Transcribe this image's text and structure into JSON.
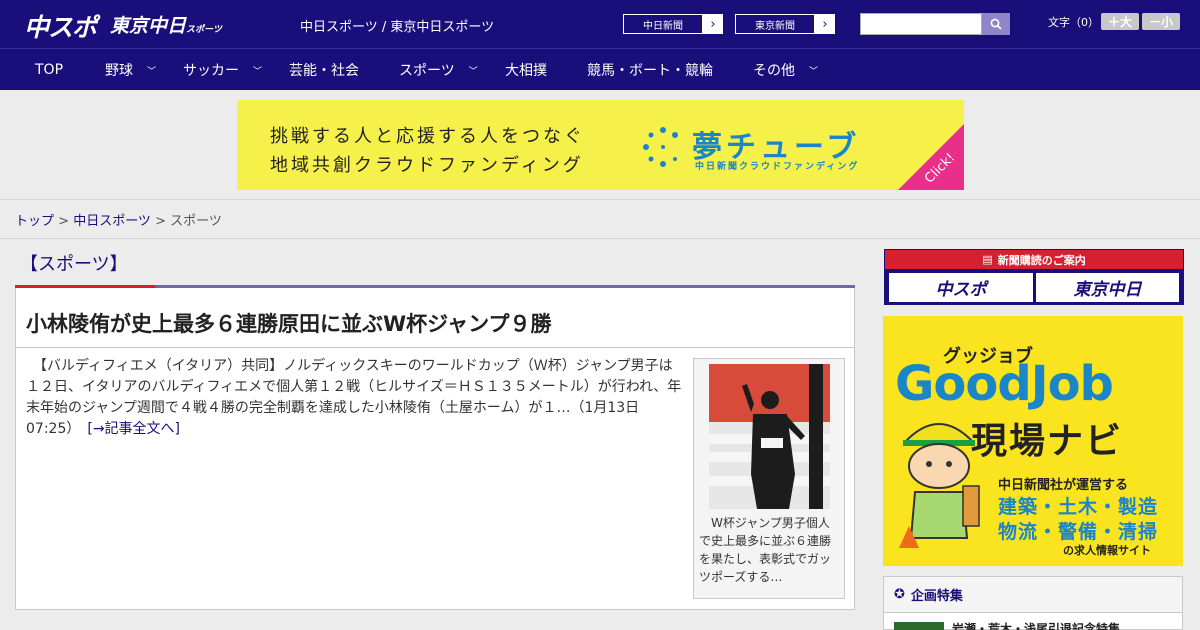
{
  "header": {
    "logo_primary": "中スポ",
    "logo_secondary": "東京中日",
    "logo_secondary_small": "スポーツ",
    "site_links": "中日スポーツ / 東京中日スポーツ",
    "paper_buttons": [
      "中日新聞",
      "東京新聞"
    ],
    "search_placeholder": "",
    "font_size_label": "文字（0）",
    "font_bigger": "＋大",
    "font_smaller": "－小"
  },
  "nav": {
    "items": [
      {
        "label": "TOP",
        "has_menu": false
      },
      {
        "label": "野球",
        "has_menu": true
      },
      {
        "label": "サッカー",
        "has_menu": true
      },
      {
        "label": "芸能・社会",
        "has_menu": false
      },
      {
        "label": "スポーツ",
        "has_menu": true
      },
      {
        "label": "大相撲",
        "has_menu": false
      },
      {
        "label": "競馬・ボート・競輪",
        "has_menu": false
      },
      {
        "label": "その他",
        "has_menu": true
      }
    ]
  },
  "banner": {
    "line1": "挑戦する人と応援する人をつなぐ",
    "line2": "地域共創クラウドファンディング",
    "brand": "夢チューブ",
    "brand_sub": "中日新聞クラウドファンディング",
    "cta": "Click!"
  },
  "breadcrumb": {
    "home": "トップ",
    "sep": " > ",
    "parent": "中日スポーツ",
    "current": "スポーツ"
  },
  "section": {
    "title": "【スポーツ】"
  },
  "article": {
    "title": "小林陵侑が史上最多６連勝原田に並ぶW杯ジャンプ９勝",
    "body": "　【バルディフィエメ（イタリア）共同】ノルディックスキーのワールドカップ（Ｗ杯）ジャンプ男子は１２日、イタリアのバルディフィエメで個人第１２戦（ヒルサイズ＝ＨＳ１３５メートル）が行われ、年末年始のジャンプ週間で４戦４勝の完全制覇を達成した小林陵侑（土屋ホーム）が１…（1月13日 07:25）　",
    "more": "[→記事全文へ]",
    "photo_caption": "　W杯ジャンプ男子個人で史上最多に並ぶ６連勝を果たし、表彰式でガッツポーズする…"
  },
  "sidebar": {
    "subscribe_head": "新聞購読のご案内",
    "subscribe_logos": [
      "中スポ",
      "東京中日"
    ],
    "goodjob_kana": "グッジョブ",
    "goodjob_title": "GoodJob",
    "goodjob_genba": "現場ナビ",
    "goodjob_line1": "中日新聞社が運営する",
    "goodjob_line2": "建築・土木・製造",
    "goodjob_line3": "物流・警備・清掃",
    "goodjob_line4": "の求人情報サイト",
    "kikaku_head": "企画特集",
    "kikaku_item": "岩瀬・荒木・浅尾引退記念特集"
  },
  "colors": {
    "brand_navy": "#1a0f7a",
    "accent_red": "#d5202f",
    "banner_yellow": "#f5f04a",
    "link": "#1a0f7a"
  }
}
